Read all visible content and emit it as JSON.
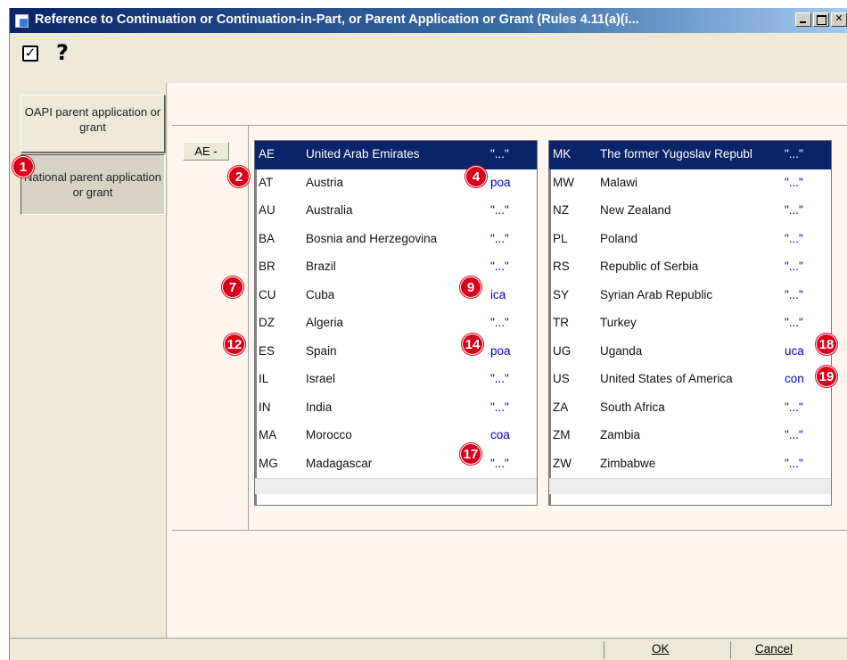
{
  "window": {
    "title": "Reference to Continuation or Continuation-in-Part, or Parent Application or Grant (Rules 4.11(a)(i...",
    "controls": [
      "minimize",
      "maximize",
      "close"
    ]
  },
  "toolbar": {
    "check_icon": "check-box-icon",
    "help_label": "?"
  },
  "sidebar": {
    "items": [
      {
        "label": "OAPI parent application or grant"
      },
      {
        "label": "National parent application or grant",
        "selected": true
      }
    ]
  },
  "country_code": "AE -",
  "left_list": [
    {
      "code": "AE",
      "name": "United Arab Emirates",
      "lang": "\"...\"",
      "selected": true
    },
    {
      "code": "AT",
      "name": "Austria",
      "lang": "poa"
    },
    {
      "code": "AU",
      "name": "Australia",
      "lang": "\"...\""
    },
    {
      "code": "BA",
      "name": "Bosnia and Herzegovina",
      "lang": "\"...\""
    },
    {
      "code": "BR",
      "name": "Brazil",
      "lang": "\"...\""
    },
    {
      "code": "CU",
      "name": "Cuba",
      "lang": "ica"
    },
    {
      "code": "DZ",
      "name": "Algeria",
      "lang": "\"...\""
    },
    {
      "code": "ES",
      "name": "Spain",
      "lang": "poa"
    },
    {
      "code": "IL",
      "name": "Israel",
      "lang": "\"...\""
    },
    {
      "code": "IN",
      "name": "India",
      "lang": "\"...\""
    },
    {
      "code": "MA",
      "name": "Morocco",
      "lang": "coa"
    },
    {
      "code": "MG",
      "name": "Madagascar",
      "lang": "\"...\""
    }
  ],
  "right_list": [
    {
      "code": "MK",
      "name": "The former Yugoslav Republ",
      "lang": "\"...\"",
      "selected": true
    },
    {
      "code": "MW",
      "name": "Malawi",
      "lang": "\"...\""
    },
    {
      "code": "NZ",
      "name": "New Zealand",
      "lang": "\"...\""
    },
    {
      "code": "PL",
      "name": "Poland",
      "lang": "\"...\""
    },
    {
      "code": "RS",
      "name": "Republic of Serbia",
      "lang": "\"...\""
    },
    {
      "code": "SY",
      "name": "Syrian Arab Republic",
      "lang": "\"...\""
    },
    {
      "code": "TR",
      "name": "Turkey",
      "lang": "\"...\""
    },
    {
      "code": "UG",
      "name": "Uganda",
      "lang": "uca"
    },
    {
      "code": "US",
      "name": "United States of America",
      "lang": "con"
    },
    {
      "code": "ZA",
      "name": "South Africa",
      "lang": "\"...\""
    },
    {
      "code": "ZM",
      "name": "Zambia",
      "lang": "\"...\""
    },
    {
      "code": "ZW",
      "name": "Zimbabwe",
      "lang": "\"...\""
    }
  ],
  "badges": [
    "1",
    "2",
    "4",
    "7",
    "9",
    "12",
    "14",
    "17",
    "18",
    "19"
  ],
  "buttons": {
    "ok": "OK",
    "cancel": "Cancel"
  },
  "colors": {
    "accent": "#0a246a",
    "badge": "#d9001b",
    "link": "#0000cc"
  }
}
